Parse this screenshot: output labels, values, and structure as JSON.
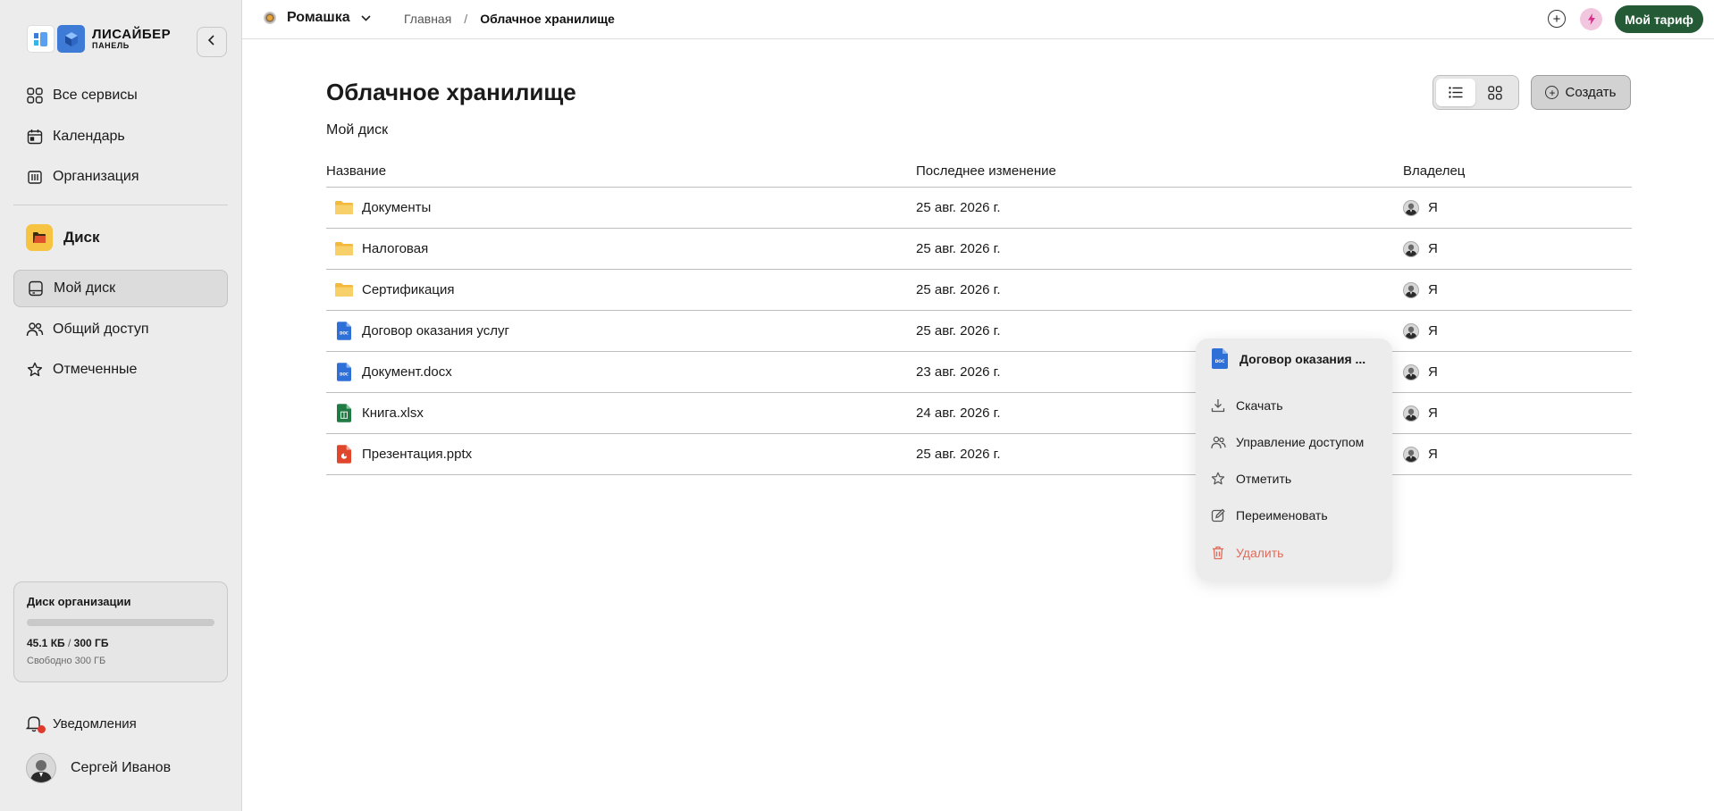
{
  "brand": {
    "name": "ЛИСАЙБЕР",
    "subtitle": "ПАНЕЛЬ"
  },
  "sidebar": {
    "nav": [
      {
        "label": "Все сервисы",
        "icon": "grid-icon"
      },
      {
        "label": "Календарь",
        "icon": "calendar-icon"
      },
      {
        "label": "Организация",
        "icon": "building-icon"
      }
    ],
    "disk_label": "Диск",
    "disk_nav": [
      {
        "label": "Мой диск",
        "icon": "drive-icon",
        "active": true
      },
      {
        "label": "Общий доступ",
        "icon": "users-icon"
      },
      {
        "label": "Отмеченные",
        "icon": "star-icon"
      }
    ],
    "storage": {
      "title": "Диск организации",
      "used": "45.1 КБ",
      "sep": "/",
      "total": "300 ГБ",
      "free": "Свободно 300 ГБ",
      "used_fraction": 0.0001
    },
    "notifications_label": "Уведомления",
    "user_name": "Сергей Иванов"
  },
  "topbar": {
    "org_name": "Ромашка",
    "breadcrumb": {
      "home": "Главная",
      "sep": "/",
      "current": "Облачное хранилище"
    },
    "tariff_label": "Мой тариф"
  },
  "main": {
    "title": "Облачное хранилище",
    "create_label": "Создать",
    "section": "Мой диск",
    "columns": {
      "name": "Название",
      "date": "Последнее изменение",
      "owner": "Владелец"
    },
    "files": [
      {
        "name": "Документы",
        "type": "folder",
        "date": "25 авг. 2026 г.",
        "owner": "Я"
      },
      {
        "name": "Налоговая",
        "type": "folder",
        "date": "25 авг. 2026 г.",
        "owner": "Я"
      },
      {
        "name": "Сертификация",
        "type": "folder",
        "date": "25 авг. 2026 г.",
        "owner": "Я"
      },
      {
        "name": "Договор оказания услуг",
        "type": "doc",
        "date": "25 авг. 2026 г.",
        "owner": "Я"
      },
      {
        "name": "Документ.docx",
        "type": "doc",
        "date": "23 авг. 2026 г.",
        "owner": "Я"
      },
      {
        "name": "Книга.xlsx",
        "type": "xls",
        "date": "24 авг. 2026 г.",
        "owner": "Я"
      },
      {
        "name": "Презентация.pptx",
        "type": "ppt",
        "date": "25 авг. 2026 г.",
        "owner": "Я"
      }
    ]
  },
  "context_menu": {
    "title": "Договор оказания ...",
    "items": [
      {
        "label": "Скачать",
        "icon": "download-icon"
      },
      {
        "label": "Управление доступом",
        "icon": "users-icon"
      },
      {
        "label": "Отметить",
        "icon": "star-icon"
      },
      {
        "label": "Переименовать",
        "icon": "edit-icon"
      },
      {
        "label": "Удалить",
        "icon": "trash-icon",
        "danger": true
      }
    ]
  },
  "colors": {
    "accent_green": "#245a36",
    "folder": "#f6c954",
    "doc": "#2f6fd8",
    "xls": "#1f7a43",
    "ppt": "#e0462b",
    "danger": "#e06b5a"
  }
}
